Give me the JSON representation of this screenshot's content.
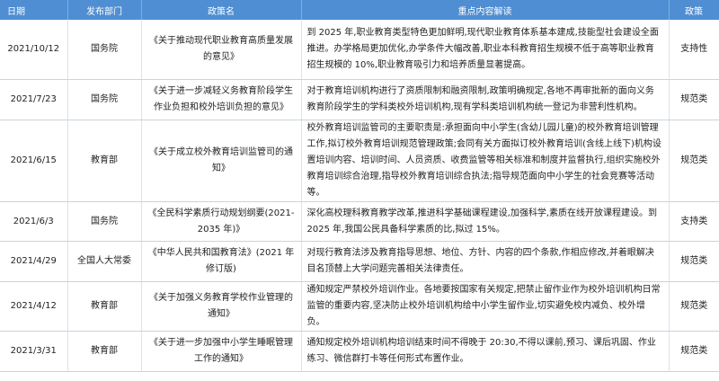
{
  "headers": [
    "日期",
    "发布部门",
    "政策名",
    "重点内容解读",
    "政策"
  ],
  "rows": [
    {
      "date": "2021/10/12",
      "dept": "国务院",
      "policy": "《关于推动现代职业教育高质量发展的意见》",
      "content": "到 2025 年,职业教育类型特色更加鲜明,现代职业教育体系基本建成,技能型社会建设全面推进。办学格局更加优化,办学条件大幅改善,职业本科教育招生规模不低于高等职业教育招生规模的 10%,职业教育吸引力和培养质量显著提高。",
      "type": "支持性"
    },
    {
      "date": "2021/7/23",
      "dept": "国务院",
      "policy": "《关于进一步减轻义务教育阶段学生作业负担和校外培训负担的意见》",
      "content": "对于教育培训机构进行了资质限制和融资限制,政策明确规定,各地不再审批新的面向义务教育阶段学生的学科类校外培训机构,现有学科类培训机构统一登记为非营利性机构。",
      "type": "规范类"
    },
    {
      "date": "2021/6/15",
      "dept": "教育部",
      "policy": "《关于成立校外教育培训监管司的通知》",
      "content": "校外教育培训监管司的主要职责是:承担面向中小学生(含幼儿园儿童)的校外教育培训管理工作,拟订校外教育培训规范管理政策;会同有关方面拟订校外教育培训(含线上线下)机构设置培训内容、培训时间、人员资质、收费监管等相关标准和制度并监督执行,组织实施校外教育培训综合治理,指导校外教育培训综合执法;指导规范面向中小学生的社会竞赛等活动等。",
      "type": "规范类"
    },
    {
      "date": "2021/6/3",
      "dept": "国务院",
      "policy": "《全民科学素质行动规划纲要(2021-2035 年)》",
      "content": "深化高校理科教育教学改革,推进科学基础课程建设,加强科学,素质在线开放课程建设。到 2025 年,我国公民具备科学素质的比,拟过 15%。",
      "type": "支持类"
    },
    {
      "date": "2021/4/29",
      "dept": "全国人大常委",
      "policy": "《中华人民共和国教育法》(2021 年修订版)",
      "content": "对现行教育法涉及教育指导思想、地位、方针、内容的四个条款,作相应修改,并着眼解决目名顶替上大学问题完善相关法律责任。",
      "type": "规范类"
    },
    {
      "date": "2021/4/12",
      "dept": "教育部",
      "policy": "《关于加强义务教育学校作业管理的通知》",
      "content": "通知规定严禁校外培训作业。各地要按国家有关规定,把禁止留作业作为校外培训机构日常监管的重要内容,坚决防止校外培训机构给中小学生留作业,切实避免校内减负、校外增负。",
      "type": "规范类"
    },
    {
      "date": "2021/3/31",
      "dept": "教育部",
      "policy": "《关于进一步加强中小学生睡眠管理工作的通知》",
      "content": "通知规定校外培训机构培训结束时间不得晚于 20:30,不得以课前,预习、课后巩固、作业练习、微信群打卡等任何形式布置作业。",
      "type": "规范类"
    }
  ]
}
